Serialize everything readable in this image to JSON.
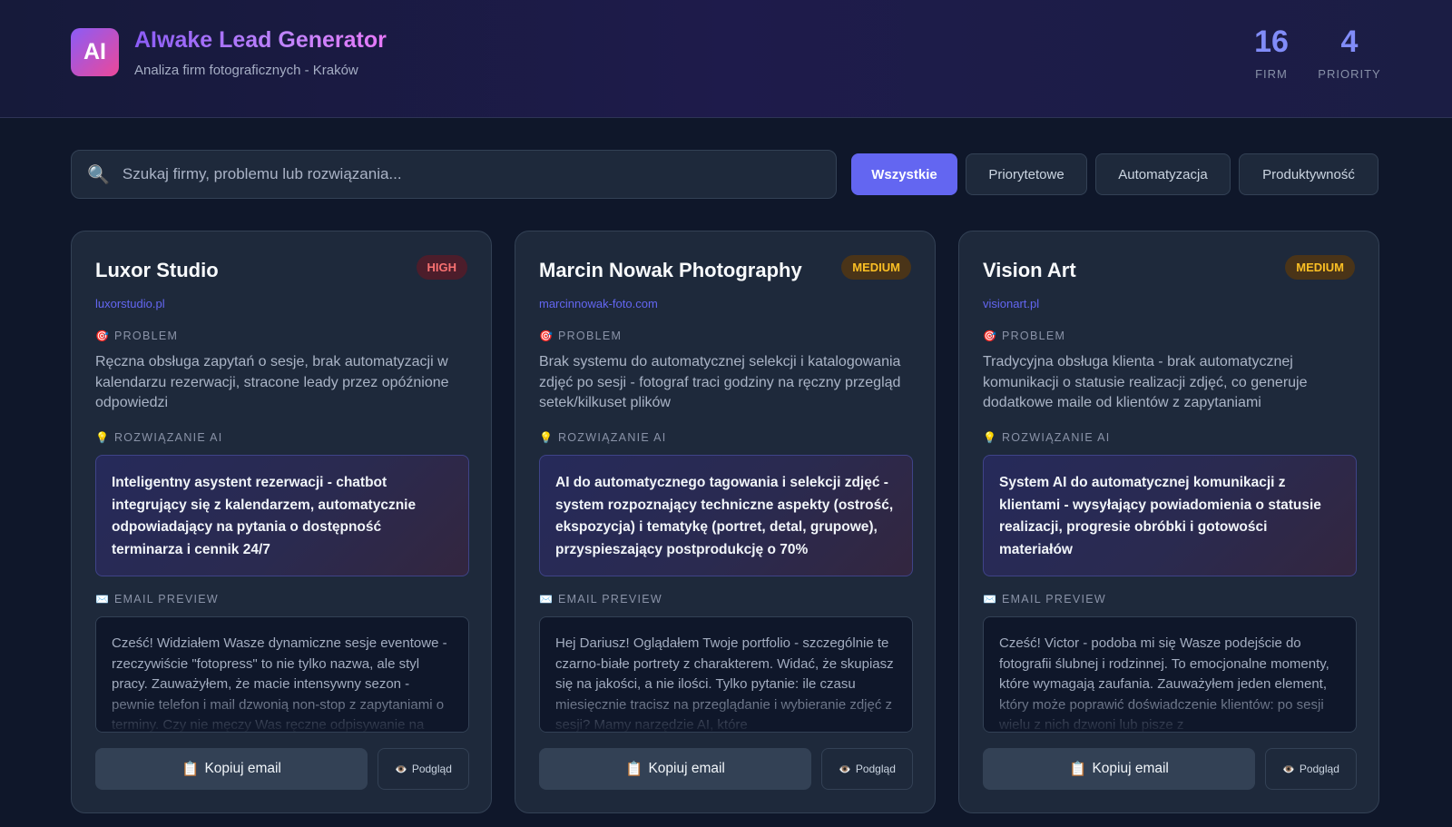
{
  "header": {
    "logo_text": "AI",
    "title": "AIwake Lead Generator",
    "subtitle": "Analiza firm fotograficznych - Kraków",
    "stats": [
      {
        "value": "16",
        "label": "FIRM"
      },
      {
        "value": "4",
        "label": "PRIORITY"
      }
    ]
  },
  "search": {
    "placeholder": "Szukaj firmy, problemu lub rozwiązania...",
    "icon": "magnifier-icon"
  },
  "filters": [
    {
      "label": "Wszystkie",
      "active": true
    },
    {
      "label": "Priorytetowe",
      "active": false
    },
    {
      "label": "Automatyzacja",
      "active": false
    },
    {
      "label": "Produktywność",
      "active": false
    }
  ],
  "labels": {
    "problem": "PROBLEM",
    "solution": "ROZWIĄZANIE AI",
    "email": "EMAIL PREVIEW",
    "copy": "Kopiuj email",
    "preview": "Podgląd"
  },
  "colors": {
    "accent": "#6366f1",
    "high": "#f87171",
    "medium": "#fbbf24",
    "background": "#0f172a",
    "card": "#1e293b"
  },
  "cards": [
    {
      "name": "Luxor Studio",
      "priority": "HIGH",
      "url": "luxorstudio.pl",
      "problem": "Ręczna obsługa zapytań o sesje, brak automatyzacji w kalendarzu rezerwacji, stracone leady przez opóźnione odpowiedzi",
      "solution": "Inteligentny asystent rezerwacji - chatbot integrujący się z kalendarzem, automatycznie odpowiadający na pytania o dostępność terminarza i cennik 24/7",
      "email": "Cześć! Widziałem Wasze dynamiczne sesje eventowe - rzeczywiście \"fotopress\" to nie tylko nazwa, ale styl pracy. Zauważyłem, że macie intensywny sezon - pewnie telefon i mail dzwonią non-stop z zapytaniami o terminy. Czy nie męczy Was ręczne odpisywanie na"
    },
    {
      "name": "Marcin Nowak Photography",
      "priority": "MEDIUM",
      "url": "marcinnowak-foto.com",
      "problem": "Brak systemu do automatycznej selekcji i katalogowania zdjęć po sesji - fotograf traci godziny na ręczny przegląd setek/kilkuset plików",
      "solution": "AI do automatycznego tagowania i selekcji zdjęć - system rozpoznający techniczne aspekty (ostrość, ekspozycja) i tematykę (portret, detal, grupowe), przyspieszający postprodukcję o 70%",
      "email": "Hej Dariusz! Oglądałem Twoje portfolio - szczególnie te czarno-białe portrety z charakterem. Widać, że skupiasz się na jakości, a nie ilości. Tylko pytanie: ile czasu miesięcznie tracisz na przeglądanie i wybieranie zdjęć z sesji? Mamy narzędzie AI, które"
    },
    {
      "name": "Vision Art",
      "priority": "MEDIUM",
      "url": "visionart.pl",
      "problem": "Tradycyjna obsługa klienta - brak automatycznej komunikacji o statusie realizacji zdjęć, co generuje dodatkowe maile od klientów z zapytaniami",
      "solution": "System AI do automatycznej komunikacji z klientami - wysyłający powiadomienia o statusie realizacji, progresie obróbki i gotowości materiałów",
      "email": "Cześć! Victor - podoba mi się Wasze podejście do fotografii ślubnej i rodzinnej. To emocjonalne momenty, które wymagają zaufania. Zauważyłem jeden element, który może poprawić doświadczenie klientów: po sesji wielu z nich dzwoni lub pisze z"
    }
  ]
}
